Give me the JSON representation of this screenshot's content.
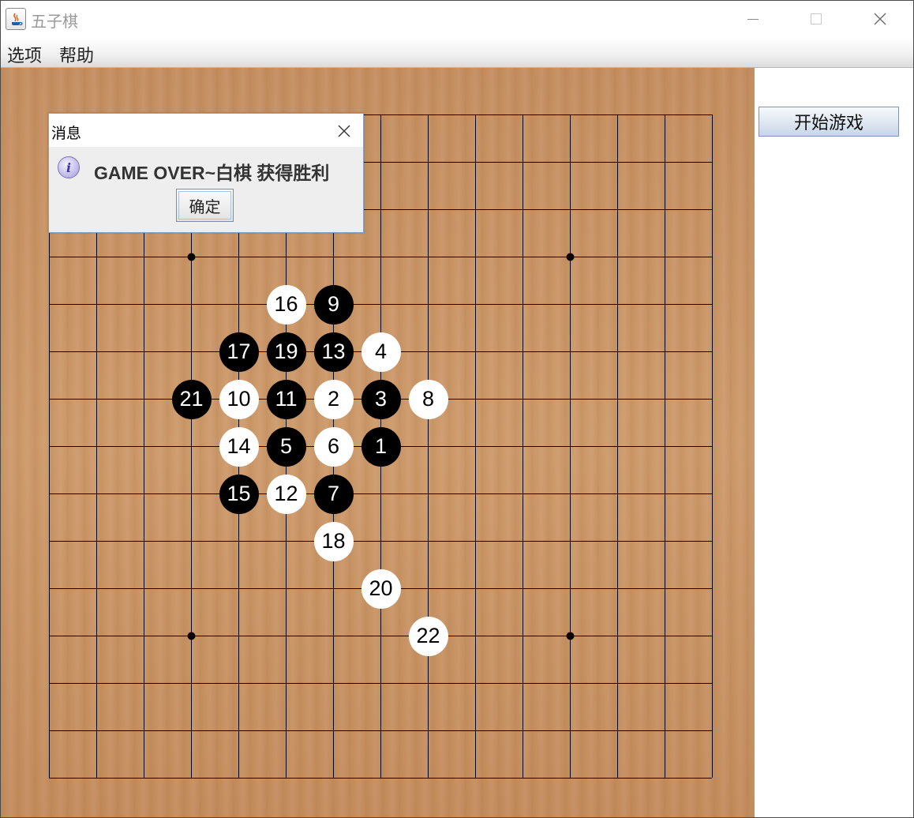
{
  "window": {
    "title": "五子棋",
    "icon": "java-coffee-icon"
  },
  "menu": {
    "items": [
      "选项",
      "帮助"
    ]
  },
  "side_panel": {
    "start_button_label": "开始游戏"
  },
  "board": {
    "size": 15,
    "line_color": "#000000",
    "wood_color": "#c9945f",
    "star_points": [
      [
        3,
        3
      ],
      [
        11,
        3
      ],
      [
        3,
        11
      ],
      [
        11,
        11
      ]
    ],
    "stones": [
      {
        "n": 1,
        "color": "black",
        "col": 7,
        "row": 7
      },
      {
        "n": 2,
        "color": "white",
        "col": 6,
        "row": 6
      },
      {
        "n": 3,
        "color": "black",
        "col": 7,
        "row": 6
      },
      {
        "n": 4,
        "color": "white",
        "col": 7,
        "row": 5
      },
      {
        "n": 5,
        "color": "black",
        "col": 5,
        "row": 7
      },
      {
        "n": 6,
        "color": "white",
        "col": 6,
        "row": 7
      },
      {
        "n": 7,
        "color": "black",
        "col": 6,
        "row": 8
      },
      {
        "n": 8,
        "color": "white",
        "col": 8,
        "row": 6
      },
      {
        "n": 9,
        "color": "black",
        "col": 6,
        "row": 4
      },
      {
        "n": 10,
        "color": "white",
        "col": 4,
        "row": 6
      },
      {
        "n": 11,
        "color": "black",
        "col": 5,
        "row": 6
      },
      {
        "n": 12,
        "color": "white",
        "col": 5,
        "row": 8
      },
      {
        "n": 13,
        "color": "black",
        "col": 6,
        "row": 5
      },
      {
        "n": 14,
        "color": "white",
        "col": 4,
        "row": 7
      },
      {
        "n": 15,
        "color": "black",
        "col": 4,
        "row": 8
      },
      {
        "n": 16,
        "color": "white",
        "col": 5,
        "row": 4
      },
      {
        "n": 17,
        "color": "black",
        "col": 4,
        "row": 5
      },
      {
        "n": 18,
        "color": "white",
        "col": 6,
        "row": 9
      },
      {
        "n": 19,
        "color": "black",
        "col": 5,
        "row": 5
      },
      {
        "n": 20,
        "color": "white",
        "col": 7,
        "row": 10
      },
      {
        "n": 21,
        "color": "black",
        "col": 3,
        "row": 6
      },
      {
        "n": 22,
        "color": "white",
        "col": 8,
        "row": 11
      }
    ]
  },
  "dialog": {
    "title": "消息",
    "message": "GAME OVER~白棋 获得胜利",
    "ok_label": "确定",
    "icon": "info-icon"
  }
}
